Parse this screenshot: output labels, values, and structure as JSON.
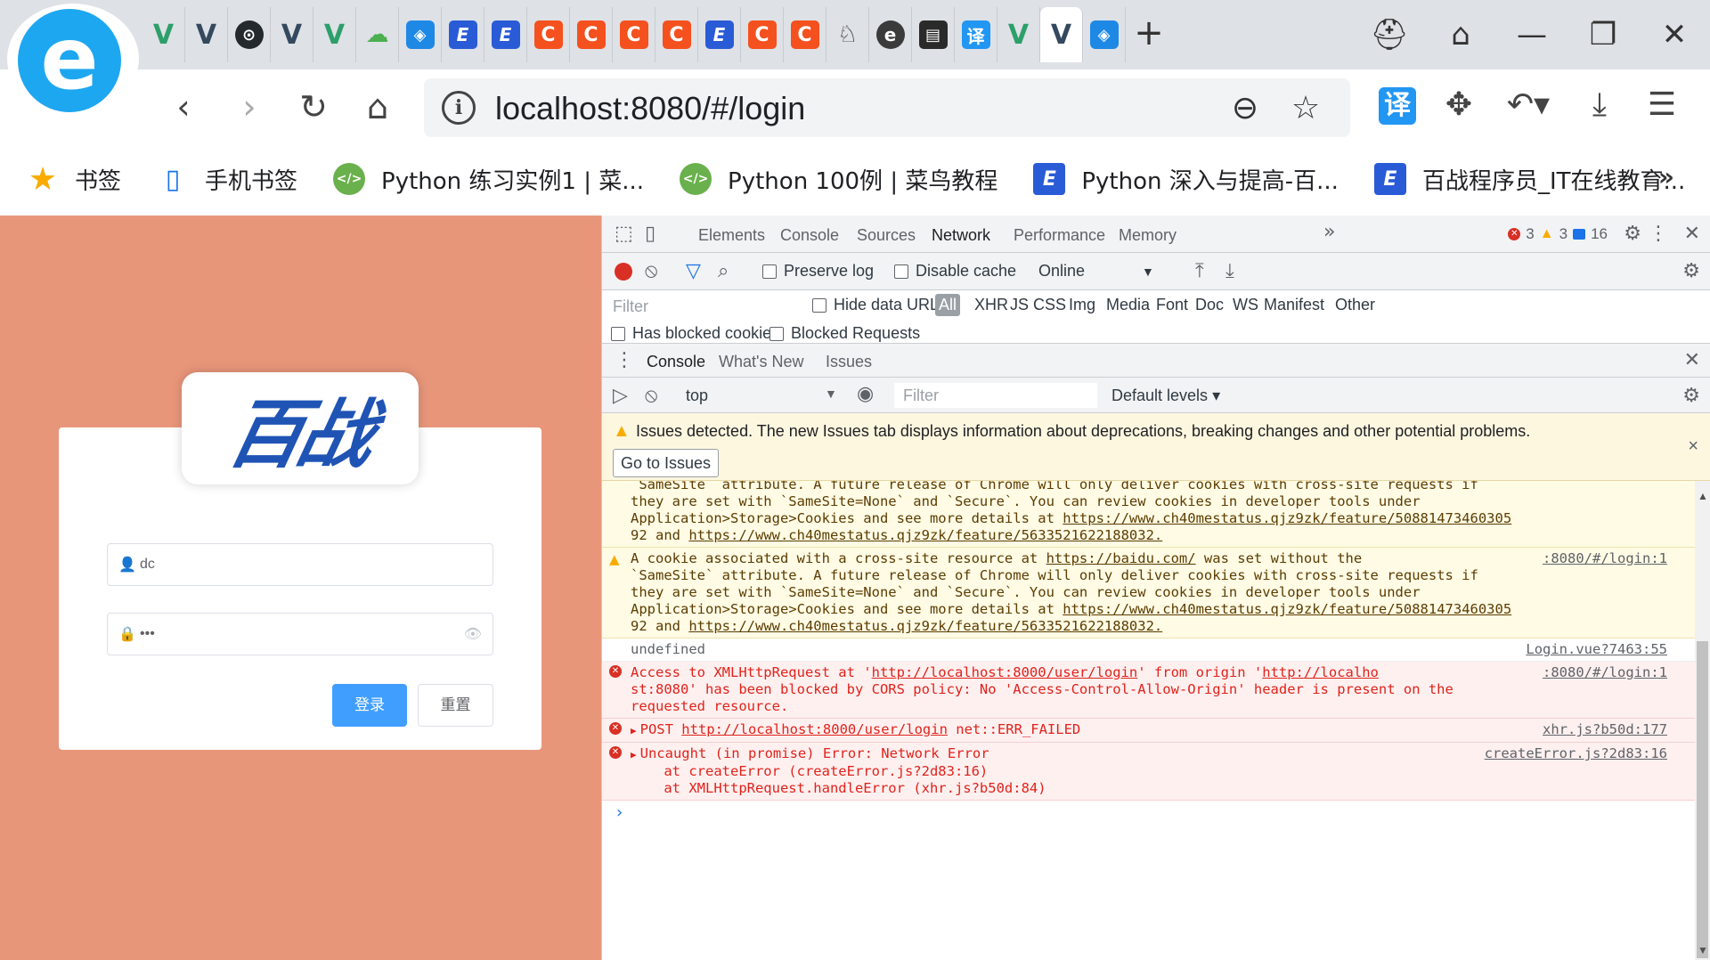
{
  "browser": {
    "tabs": [
      {
        "icon": "vue-icon",
        "cls": "vue"
      },
      {
        "icon": "vue-icon",
        "cls": "vue"
      },
      {
        "icon": "github-icon",
        "cls": "github"
      },
      {
        "icon": "vue-icon",
        "cls": "vue"
      },
      {
        "icon": "vue-icon",
        "cls": "vue"
      },
      {
        "icon": "cloud-icon",
        "cls": "cloud"
      },
      {
        "icon": "box-icon",
        "cls": "box"
      },
      {
        "icon": "baizhan-icon",
        "cls": "bz"
      },
      {
        "icon": "baizhan-icon",
        "cls": "bz"
      },
      {
        "icon": "c-icon",
        "cls": "cr"
      },
      {
        "icon": "c-icon",
        "cls": "cr"
      },
      {
        "icon": "c-icon",
        "cls": "cr"
      },
      {
        "icon": "c-icon",
        "cls": "cr"
      },
      {
        "icon": "baizhan-icon",
        "cls": "bz"
      },
      {
        "icon": "c-icon",
        "cls": "cr"
      },
      {
        "icon": "c-icon",
        "cls": "cr"
      },
      {
        "icon": "swan-icon",
        "cls": "swan"
      },
      {
        "icon": "e-circle-icon",
        "cls": "ecir"
      },
      {
        "icon": "book-icon",
        "cls": "book"
      },
      {
        "icon": "translate-icon",
        "cls": "trans"
      },
      {
        "icon": "vue-icon",
        "cls": "vue"
      },
      {
        "icon": "vue-icon",
        "cls": "vue",
        "active": true
      },
      {
        "icon": "box-icon",
        "cls": "box"
      }
    ],
    "address": "localhost:8080/#/login",
    "bookmarks": [
      {
        "label": "书签",
        "icon": "star-icon",
        "cls": "star"
      },
      {
        "label": "手机书签",
        "icon": "phone-bookmark-icon",
        "cls": "phone"
      },
      {
        "label": "Python 练习实例1 | 菜...",
        "icon": "runoob-icon",
        "cls": "runoob"
      },
      {
        "label": "Python 100例 | 菜鸟教程",
        "icon": "runoob-icon",
        "cls": "runoob"
      },
      {
        "label": "Python 深入与提高-百...",
        "icon": "baizhan-icon",
        "cls": "bz"
      },
      {
        "label": "百战程序员_IT在线教育...",
        "icon": "baizhan-icon",
        "cls": "bz"
      }
    ]
  },
  "login": {
    "logo_text": "百战",
    "username": "dc",
    "password": "•••",
    "login_label": "登录",
    "reset_label": "重置"
  },
  "devtools": {
    "tabs": [
      "Elements",
      "Console",
      "Sources",
      "Network",
      "Performance",
      "Memory"
    ],
    "active_tab": "Network",
    "error_count": "3",
    "warning_count": "3",
    "info_count": "16",
    "network": {
      "preserve_log": "Preserve log",
      "disable_cache": "Disable cache",
      "throttle": "Online",
      "filter_placeholder": "Filter",
      "hide_data_urls": "Hide data URLs",
      "types": [
        "All",
        "XHR",
        "JS",
        "CSS",
        "Img",
        "Media",
        "Font",
        "Doc",
        "WS",
        "Manifest",
        "Other"
      ],
      "has_blocked_cookies": "Has blocked cookies",
      "blocked_requests": "Blocked Requests"
    },
    "drawer_tabs": [
      "Console",
      "What's New",
      "Issues"
    ],
    "console": {
      "context": "top",
      "filter_placeholder": "Filter",
      "levels": "Default levels",
      "issues_message": "Issues detected. The new Issues tab displays information about deprecations, breaking changes and other potential problems.",
      "go_to_issues": "Go to Issues",
      "messages": [
        {
          "type": "warn",
          "partial": true,
          "lines": [
            "`SameSite` attribute. A future release of Chrome will only deliver cookies with cross-site requests if",
            "they are set with `SameSite=None` and `Secure`. You can review cookies in developer tools under",
            "Application>Storage>Cookies and see more details at https://www.ch40mestatus.qjz9zk/feature/50881473460305",
            "92 and https://www.ch40mestatus.qjz9zk/feature/5633521622188032."
          ]
        },
        {
          "type": "warn",
          "source": ":8080/#/login:1",
          "lines": [
            "A cookie associated with a cross-site resource at https://baidu.com/ was set without the",
            "`SameSite` attribute. A future release of Chrome will only deliver cookies with cross-site requests if",
            "they are set with `SameSite=None` and `Secure`. You can review cookies in developer tools under",
            "Application>Storage>Cookies and see more details at https://www.ch40mestatus.qjz9zk/feature/50881473460305",
            "92 and https://www.ch40mestatus.qjz9zk/feature/5633521622188032."
          ]
        },
        {
          "type": "info",
          "source": "Login.vue?7463:55",
          "lines": [
            "undefined"
          ]
        },
        {
          "type": "error",
          "source": ":8080/#/login:1",
          "lines": [
            "Access to XMLHttpRequest at 'http://localhost:8000/user/login' from origin 'http://localho",
            "st:8080' has been blocked by CORS policy: No 'Access-Control-Allow-Origin' header is present on the",
            "requested resource."
          ]
        },
        {
          "type": "error",
          "source": "xhr.js?b50d:177",
          "expandable": true,
          "lines": [
            "POST http://localhost:8000/user/login net::ERR_FAILED"
          ]
        },
        {
          "type": "error",
          "source": "createError.js?2d83:16",
          "expandable": true,
          "lines": [
            "Uncaught (in promise) Error: Network Error",
            "    at createError (createError.js?2d83:16)",
            "    at XMLHttpRequest.handleError (xhr.js?b50d:84)"
          ]
        }
      ]
    }
  }
}
